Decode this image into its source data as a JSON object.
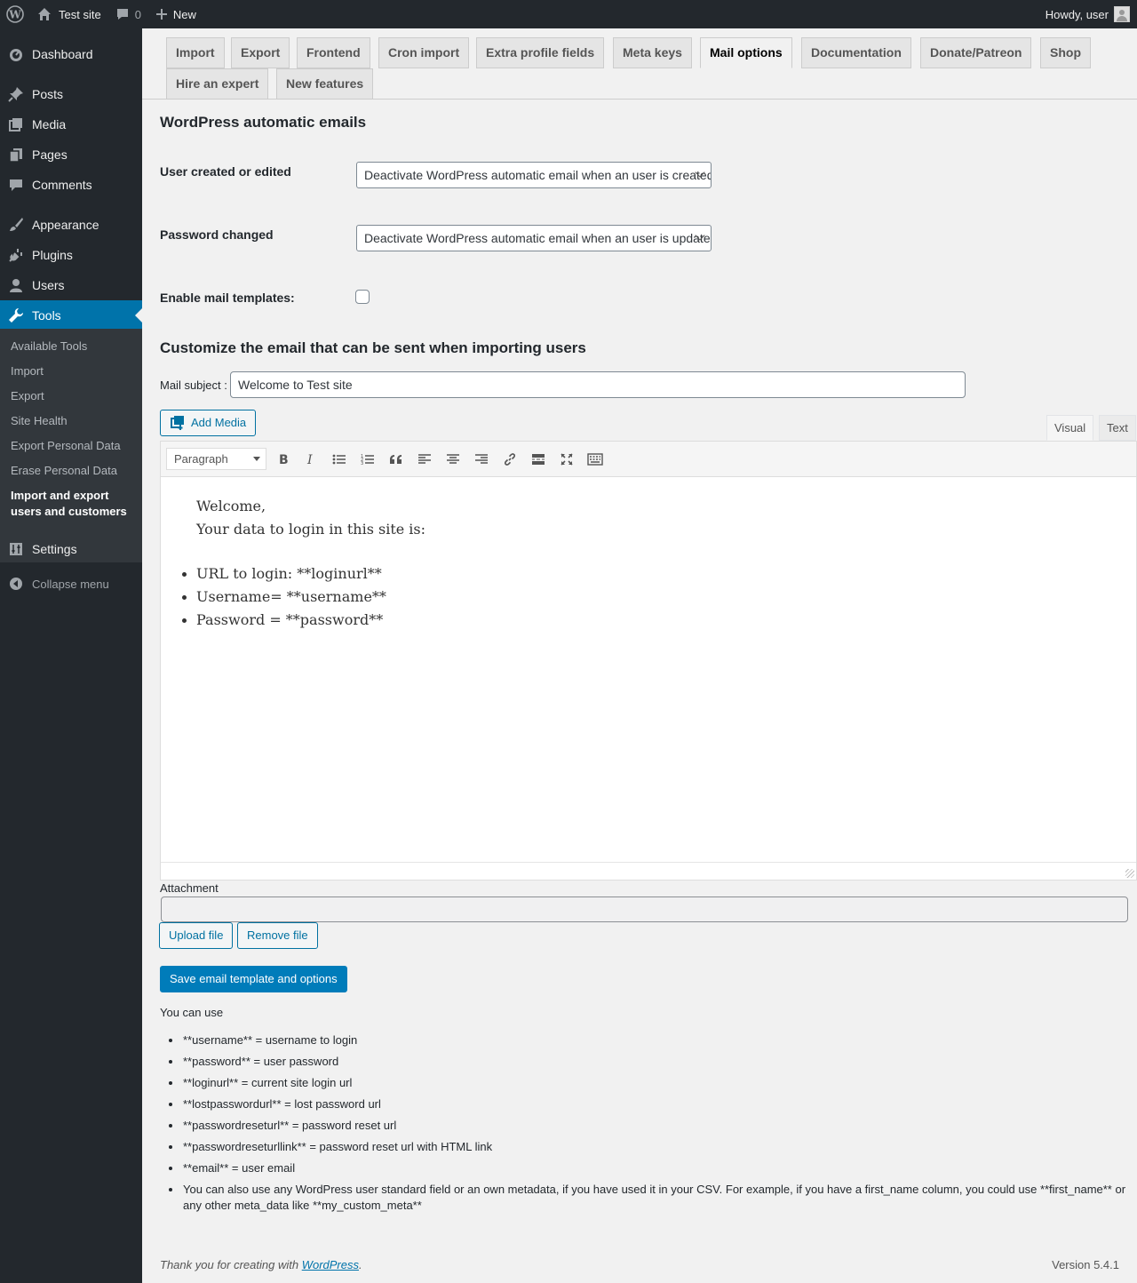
{
  "adminbar": {
    "site_name": "Test site",
    "comments_count": "0",
    "new_label": "New",
    "howdy": "Howdy, user"
  },
  "sidebar": {
    "items": [
      {
        "label": "Dashboard",
        "icon": "dashboard-icon"
      },
      {
        "label": "Posts",
        "icon": "pin-icon"
      },
      {
        "label": "Media",
        "icon": "media-icon"
      },
      {
        "label": "Pages",
        "icon": "pages-icon"
      },
      {
        "label": "Comments",
        "icon": "comment-icon"
      },
      {
        "label": "Appearance",
        "icon": "brush-icon"
      },
      {
        "label": "Plugins",
        "icon": "plug-icon"
      },
      {
        "label": "Users",
        "icon": "user-icon"
      },
      {
        "label": "Tools",
        "icon": "wrench-icon"
      },
      {
        "label": "Settings",
        "icon": "settings-icon"
      }
    ],
    "submenu": [
      "Available Tools",
      "Import",
      "Export",
      "Site Health",
      "Export Personal Data",
      "Erase Personal Data",
      "Import and export users and customers"
    ],
    "collapse": "Collapse menu"
  },
  "tabs": [
    "Import",
    "Export",
    "Frontend",
    "Cron import",
    "Extra profile fields",
    "Meta keys",
    "Mail options",
    "Documentation",
    "Donate/Patreon",
    "Shop",
    "Hire an expert",
    "New features"
  ],
  "active_tab": "Mail options",
  "section1": {
    "title": "WordPress automatic emails",
    "user_created_label": "User created or edited",
    "user_created_value": "Deactivate WordPress automatic email when an user is created or edited",
    "password_changed_label": "Password changed",
    "password_changed_value": "Deactivate WordPress automatic email when an user is updated or his password is changed",
    "enable_templates_label": "Enable mail templates:"
  },
  "section2": {
    "title": "Customize the email that can be sent when importing users",
    "mail_subject_label": "Mail subject :",
    "mail_subject_value": "Welcome to Test site",
    "add_media": "Add Media",
    "tab_visual": "Visual",
    "tab_text": "Text",
    "format": "Paragraph"
  },
  "editor": {
    "line1": "Welcome,",
    "line2": "Your data to login in this site is:",
    "bullets": [
      "URL to login: **loginurl**",
      "Username= **username**",
      "Password = **password**"
    ]
  },
  "attachment": {
    "label": "Attachment",
    "upload": "Upload file",
    "remove": "Remove file"
  },
  "save_button": "Save email template and options",
  "help": {
    "title": "You can use",
    "items": [
      "**username** = username to login",
      "**password** = user password",
      "**loginurl** = current site login url",
      "**lostpasswordurl** = lost password url",
      "**passwordreseturl** = password reset url",
      "**passwordreseturllink** = password reset url with HTML link",
      "**email** = user email",
      "You can also use any WordPress user standard field or an own metadata, if you have used it in your CSV. For example, if you have a first_name column, you could use **first_name** or any other meta_data like **my_custom_meta**"
    ]
  },
  "footer": {
    "thanks_prefix": "Thank you for creating with ",
    "thanks_link": "WordPress",
    "thanks_suffix": ".",
    "version": "Version 5.4.1"
  },
  "colors": {
    "admin_dark": "#23282d",
    "accent": "#0073aa",
    "primary_button": "#007cba"
  }
}
